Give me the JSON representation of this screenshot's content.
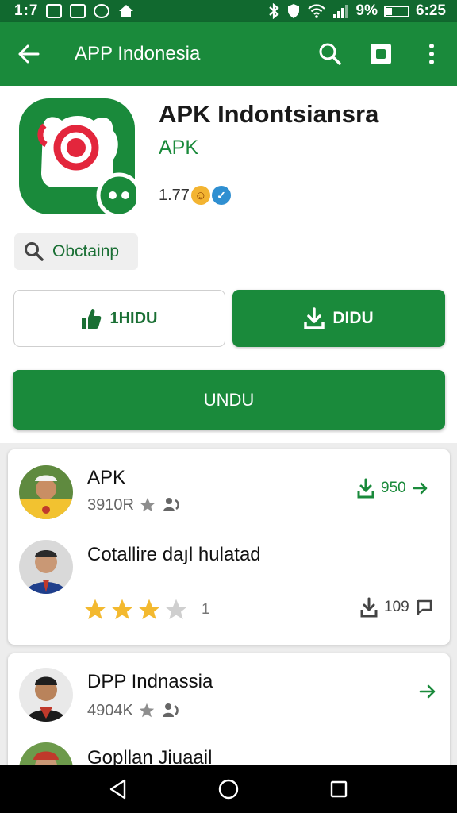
{
  "status_bar": {
    "left_time": "1:7",
    "battery_percent": "9%",
    "clock": "6:25"
  },
  "app_bar": {
    "title": "APP Indonesia"
  },
  "app_header": {
    "name": "APK Indontsiansra",
    "type": "APK",
    "rating": "1.77",
    "icon_color": "#1a8a3b",
    "search_chip_label": "Obctainp"
  },
  "buttons": {
    "outline_label": "1HIDU",
    "filled_label": "DIDU",
    "wide_label": "UNDU"
  },
  "cards": [
    {
      "items": [
        {
          "name": "APK",
          "meta": "3910R",
          "download_count": "950",
          "has_arrow": true
        },
        {
          "name": "Cotallire daյl hulatad",
          "stars_filled": 3,
          "stars_total": 4,
          "star_count": "1",
          "download_count": "109"
        }
      ]
    },
    {
      "items": [
        {
          "name": "DPP Indnassia",
          "meta": "4904K",
          "has_arrow": true
        },
        {
          "name": "Gopllan Jiuaail"
        }
      ]
    }
  ],
  "colors": {
    "primary": "#1a8a3b",
    "primary_dark": "#11692f",
    "star": "#f3b92f"
  }
}
